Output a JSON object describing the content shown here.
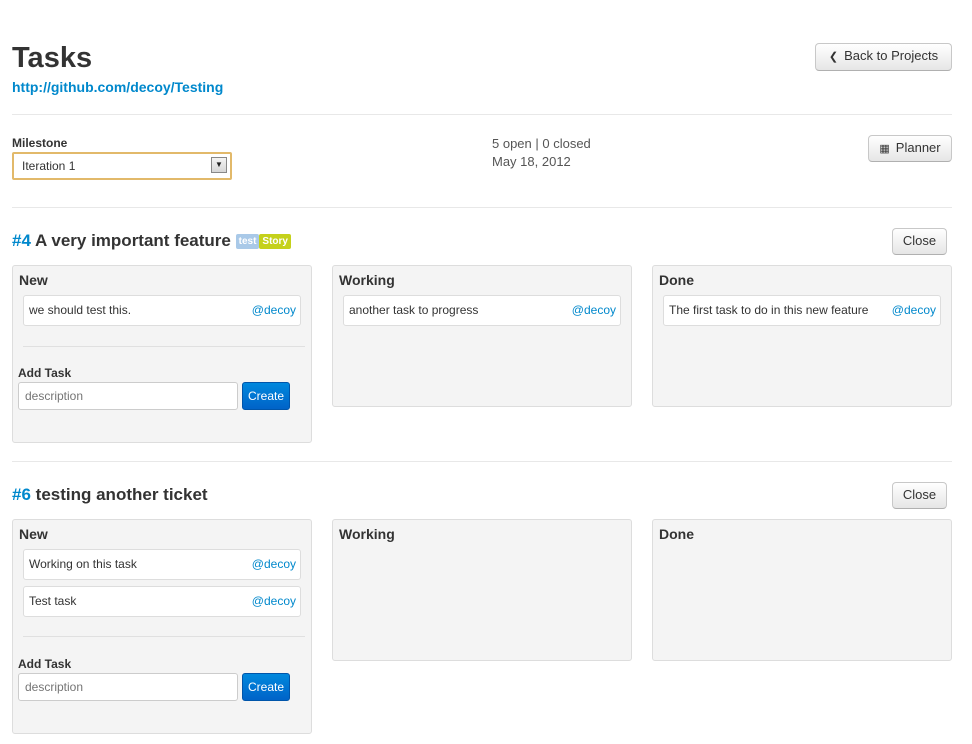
{
  "header": {
    "title": "Tasks",
    "repo_url": "http://github.com/decoy/Testing",
    "back_button": "Back to Projects",
    "back_icon": "chevron-left-icon"
  },
  "milestone": {
    "label": "Milestone",
    "selected": "Iteration 1",
    "stats": "5 open | 0 closed",
    "date": "May 18, 2012",
    "planner_button": "Planner",
    "planner_icon": "calendar-icon"
  },
  "tickets": [
    {
      "number": "#4",
      "title": "A very important feature",
      "labels": [
        {
          "text": "test",
          "color": "#a9c9e8"
        },
        {
          "text": "Story",
          "color": "#c5d11b"
        }
      ],
      "close_button": "Close",
      "columns": {
        "new": {
          "title": "New",
          "tasks": [
            {
              "text": "we should test this.",
              "owner": "@decoy"
            }
          ],
          "add_label": "Add Task",
          "input_placeholder": "description",
          "create_button": "Create"
        },
        "working": {
          "title": "Working",
          "tasks": [
            {
              "text": "another task to progress",
              "owner": "@decoy"
            }
          ]
        },
        "done": {
          "title": "Done",
          "tasks": [
            {
              "text": "The first task to do in this new feature",
              "owner": "@decoy"
            }
          ]
        }
      }
    },
    {
      "number": "#6",
      "title": "testing another ticket",
      "labels": [],
      "close_button": "Close",
      "columns": {
        "new": {
          "title": "New",
          "tasks": [
            {
              "text": "Working on this task",
              "owner": "@decoy"
            },
            {
              "text": "Test task",
              "owner": "@decoy"
            }
          ],
          "add_label": "Add Task",
          "input_placeholder": "description",
          "create_button": "Create"
        },
        "working": {
          "title": "Working",
          "tasks": []
        },
        "done": {
          "title": "Done",
          "tasks": []
        }
      }
    }
  ],
  "colors": {
    "link": "#0088cc",
    "primary_button": "#0070d0",
    "select_focus": "#e2b96a",
    "column_bg": "#f4f4f4"
  }
}
